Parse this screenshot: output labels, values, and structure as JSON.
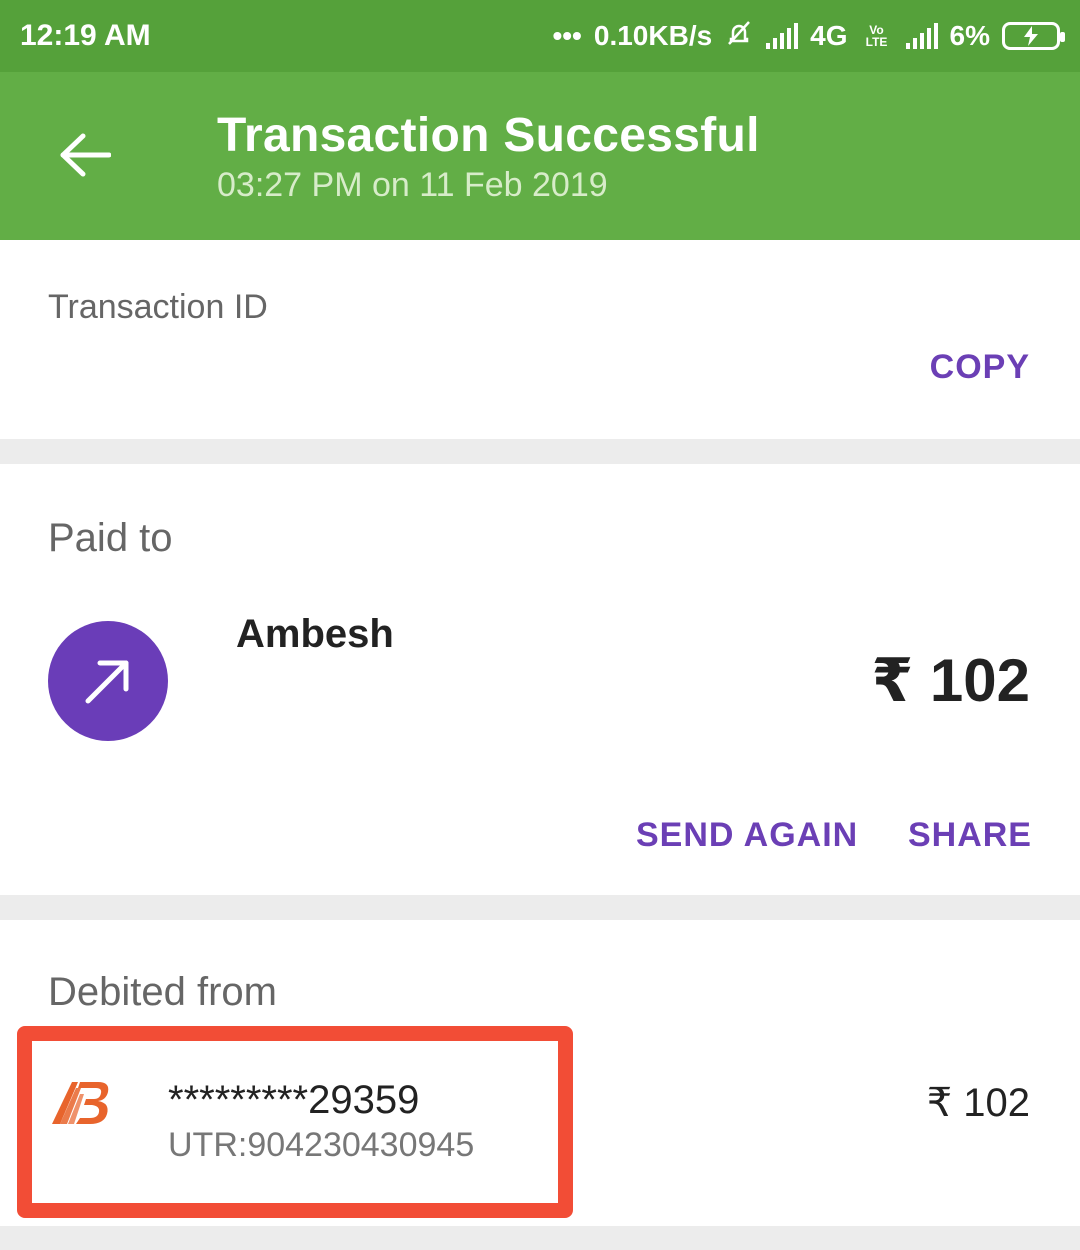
{
  "status_bar": {
    "time": "12:19 AM",
    "dots": "•••",
    "network_speed": "0.10KB/s",
    "network_type": "4G",
    "volte": "Vo LTE",
    "battery": "6%"
  },
  "header": {
    "title": "Transaction Successful",
    "subtitle": "03:27 PM on 11 Feb 2019"
  },
  "transaction": {
    "label": "Transaction ID",
    "copy_label": "COPY"
  },
  "paid_to": {
    "label": "Paid to",
    "name": "Ambesh",
    "amount": "₹ 102",
    "send_again_label": "SEND AGAIN",
    "share_label": "SHARE"
  },
  "debited_from": {
    "label": "Debited from",
    "account": "*********29359",
    "utr": "UTR:904230430945",
    "amount": "₹ 102"
  },
  "colors": {
    "status_bar": "#55a13a",
    "app_bar": "#62ae46",
    "accent": "#6b3fb5",
    "highlight": "#f24d36",
    "bank_logo": "#e8642c"
  }
}
